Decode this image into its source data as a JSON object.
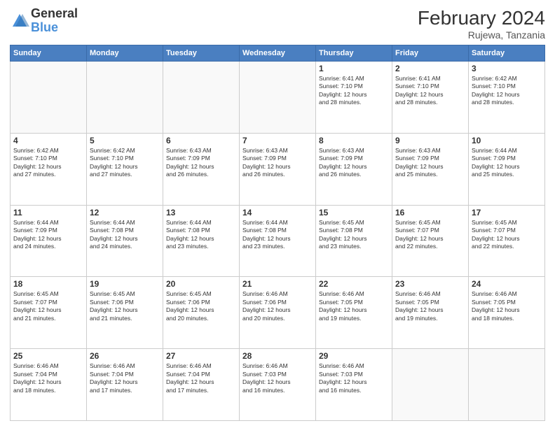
{
  "logo": {
    "general": "General",
    "blue": "Blue"
  },
  "header": {
    "month_year": "February 2024",
    "location": "Rujewa, Tanzania"
  },
  "weekdays": [
    "Sunday",
    "Monday",
    "Tuesday",
    "Wednesday",
    "Thursday",
    "Friday",
    "Saturday"
  ],
  "weeks": [
    [
      {
        "day": "",
        "info": ""
      },
      {
        "day": "",
        "info": ""
      },
      {
        "day": "",
        "info": ""
      },
      {
        "day": "",
        "info": ""
      },
      {
        "day": "1",
        "info": "Sunrise: 6:41 AM\nSunset: 7:10 PM\nDaylight: 12 hours\nand 28 minutes."
      },
      {
        "day": "2",
        "info": "Sunrise: 6:41 AM\nSunset: 7:10 PM\nDaylight: 12 hours\nand 28 minutes."
      },
      {
        "day": "3",
        "info": "Sunrise: 6:42 AM\nSunset: 7:10 PM\nDaylight: 12 hours\nand 28 minutes."
      }
    ],
    [
      {
        "day": "4",
        "info": "Sunrise: 6:42 AM\nSunset: 7:10 PM\nDaylight: 12 hours\nand 27 minutes."
      },
      {
        "day": "5",
        "info": "Sunrise: 6:42 AM\nSunset: 7:10 PM\nDaylight: 12 hours\nand 27 minutes."
      },
      {
        "day": "6",
        "info": "Sunrise: 6:43 AM\nSunset: 7:09 PM\nDaylight: 12 hours\nand 26 minutes."
      },
      {
        "day": "7",
        "info": "Sunrise: 6:43 AM\nSunset: 7:09 PM\nDaylight: 12 hours\nand 26 minutes."
      },
      {
        "day": "8",
        "info": "Sunrise: 6:43 AM\nSunset: 7:09 PM\nDaylight: 12 hours\nand 26 minutes."
      },
      {
        "day": "9",
        "info": "Sunrise: 6:43 AM\nSunset: 7:09 PM\nDaylight: 12 hours\nand 25 minutes."
      },
      {
        "day": "10",
        "info": "Sunrise: 6:44 AM\nSunset: 7:09 PM\nDaylight: 12 hours\nand 25 minutes."
      }
    ],
    [
      {
        "day": "11",
        "info": "Sunrise: 6:44 AM\nSunset: 7:09 PM\nDaylight: 12 hours\nand 24 minutes."
      },
      {
        "day": "12",
        "info": "Sunrise: 6:44 AM\nSunset: 7:08 PM\nDaylight: 12 hours\nand 24 minutes."
      },
      {
        "day": "13",
        "info": "Sunrise: 6:44 AM\nSunset: 7:08 PM\nDaylight: 12 hours\nand 23 minutes."
      },
      {
        "day": "14",
        "info": "Sunrise: 6:44 AM\nSunset: 7:08 PM\nDaylight: 12 hours\nand 23 minutes."
      },
      {
        "day": "15",
        "info": "Sunrise: 6:45 AM\nSunset: 7:08 PM\nDaylight: 12 hours\nand 23 minutes."
      },
      {
        "day": "16",
        "info": "Sunrise: 6:45 AM\nSunset: 7:07 PM\nDaylight: 12 hours\nand 22 minutes."
      },
      {
        "day": "17",
        "info": "Sunrise: 6:45 AM\nSunset: 7:07 PM\nDaylight: 12 hours\nand 22 minutes."
      }
    ],
    [
      {
        "day": "18",
        "info": "Sunrise: 6:45 AM\nSunset: 7:07 PM\nDaylight: 12 hours\nand 21 minutes."
      },
      {
        "day": "19",
        "info": "Sunrise: 6:45 AM\nSunset: 7:06 PM\nDaylight: 12 hours\nand 21 minutes."
      },
      {
        "day": "20",
        "info": "Sunrise: 6:45 AM\nSunset: 7:06 PM\nDaylight: 12 hours\nand 20 minutes."
      },
      {
        "day": "21",
        "info": "Sunrise: 6:46 AM\nSunset: 7:06 PM\nDaylight: 12 hours\nand 20 minutes."
      },
      {
        "day": "22",
        "info": "Sunrise: 6:46 AM\nSunset: 7:05 PM\nDaylight: 12 hours\nand 19 minutes."
      },
      {
        "day": "23",
        "info": "Sunrise: 6:46 AM\nSunset: 7:05 PM\nDaylight: 12 hours\nand 19 minutes."
      },
      {
        "day": "24",
        "info": "Sunrise: 6:46 AM\nSunset: 7:05 PM\nDaylight: 12 hours\nand 18 minutes."
      }
    ],
    [
      {
        "day": "25",
        "info": "Sunrise: 6:46 AM\nSunset: 7:04 PM\nDaylight: 12 hours\nand 18 minutes."
      },
      {
        "day": "26",
        "info": "Sunrise: 6:46 AM\nSunset: 7:04 PM\nDaylight: 12 hours\nand 17 minutes."
      },
      {
        "day": "27",
        "info": "Sunrise: 6:46 AM\nSunset: 7:04 PM\nDaylight: 12 hours\nand 17 minutes."
      },
      {
        "day": "28",
        "info": "Sunrise: 6:46 AM\nSunset: 7:03 PM\nDaylight: 12 hours\nand 16 minutes."
      },
      {
        "day": "29",
        "info": "Sunrise: 6:46 AM\nSunset: 7:03 PM\nDaylight: 12 hours\nand 16 minutes."
      },
      {
        "day": "",
        "info": ""
      },
      {
        "day": "",
        "info": ""
      }
    ]
  ]
}
